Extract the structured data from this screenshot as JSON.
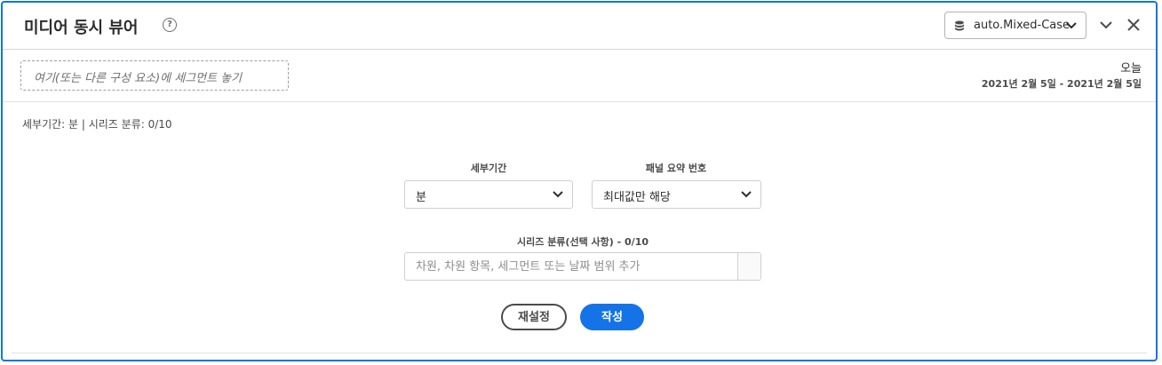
{
  "header": {
    "title": "미디어 동시 뷰어",
    "help_icon": "?",
    "report_suite": "auto.Mixed-Case",
    "icons": [
      "help-icon",
      "database-icon",
      "chevron-down-icon",
      "collapse-icon",
      "close-icon"
    ]
  },
  "segment": {
    "dropzone_text": "여기(또는 다른 구성 요소)에 세그먼트 놓기"
  },
  "date": {
    "label": "오늘",
    "range": "2021년 2월 5일 - 2021년 2월 5일"
  },
  "summary": "세부기간: 분 | 시리즈 분류: 0/10",
  "form": {
    "granularity_label": "세부기간",
    "granularity_value": "분",
    "panel_summary_label": "패널 요약 번호",
    "panel_summary_value": "최대값만 해당",
    "breakdown_label": "시리즈 분류(선택 사항) - 0/10",
    "breakdown_placeholder": "차원, 차원 항목, 세그먼트 또는 날짜 범위 추가",
    "reset_label": "재설정",
    "create_label": "작성"
  },
  "colors": {
    "accent": "#1473e6",
    "text": "#2c2c2c",
    "border": "#cfcfcf"
  }
}
